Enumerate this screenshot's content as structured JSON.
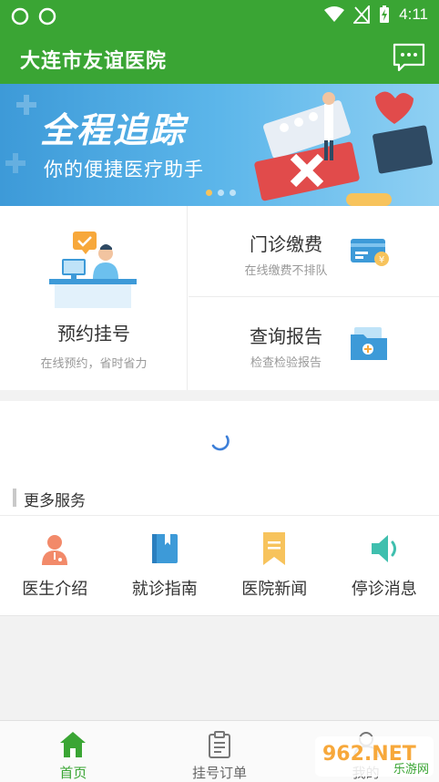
{
  "status_bar": {
    "time": "4:11"
  },
  "header": {
    "title": "大连市友谊医院",
    "message_icon": "chat-icon"
  },
  "banner": {
    "title": "全程追踪",
    "subtitle": "你的便捷医疗助手",
    "slide_count": 3,
    "active_slide": 1
  },
  "services": {
    "appointment": {
      "title": "预约挂号",
      "subtitle": "在线预约，省时省力"
    },
    "payment": {
      "title": "门诊缴费",
      "subtitle": "在线缴费不排队"
    },
    "report": {
      "title": "查询报告",
      "subtitle": "检查检验报告"
    }
  },
  "more_services": {
    "heading": "更多服务",
    "items": [
      {
        "label": "医生介绍",
        "icon": "doctor-icon"
      },
      {
        "label": "就诊指南",
        "icon": "book-icon"
      },
      {
        "label": "医院新闻",
        "icon": "bookmark-icon"
      },
      {
        "label": "停诊消息",
        "icon": "speaker-icon"
      }
    ]
  },
  "bottom_nav": {
    "items": [
      {
        "label": "首页",
        "icon": "home-icon",
        "active": true
      },
      {
        "label": "挂号订单",
        "icon": "clipboard-icon",
        "active": false
      },
      {
        "label": "我的",
        "icon": "user-icon",
        "active": false
      }
    ]
  },
  "watermark": {
    "text": "962.NET",
    "subtext": "乐游网"
  },
  "colors": {
    "primary": "#3aa534",
    "accent_orange": "#f7a83b",
    "accent_blue": "#3d9ad8"
  }
}
